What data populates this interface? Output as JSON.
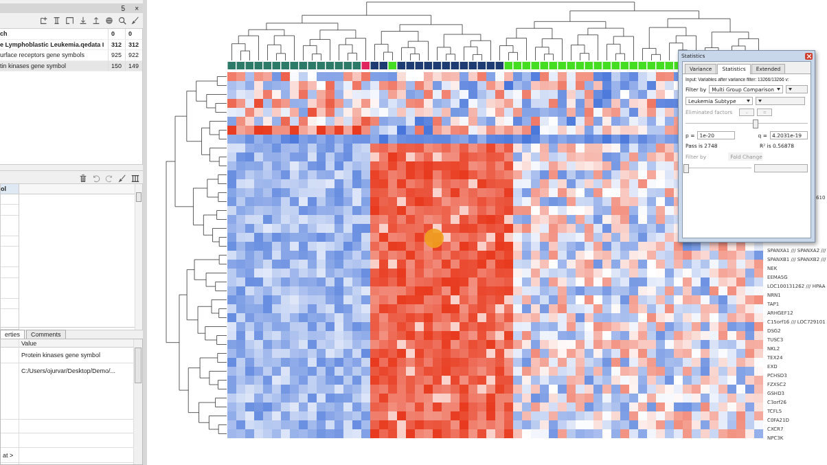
{
  "datasets_panel": {
    "float_button": "5",
    "close_button": "×",
    "rows": [
      {
        "name": "ch",
        "count_1": "0",
        "count_2": "0",
        "bold": true,
        "selected": false
      },
      {
        "name": "e Lymphoblastic Leukemia.qedata I",
        "count_1": "312",
        "count_2": "312",
        "bold": true,
        "selected": false
      },
      {
        "name": "urface receptors gene symbols",
        "count_1": "925",
        "count_2": "922",
        "bold": false,
        "selected": false
      },
      {
        "name": "tin kinases gene symbol",
        "count_1": "150",
        "count_2": "149",
        "bold": false,
        "selected": true
      }
    ]
  },
  "columns_panel": {
    "header": "ol"
  },
  "properties_panel": {
    "tabs": [
      {
        "label": "erties",
        "selected": true
      },
      {
        "label": "Comments",
        "selected": false
      }
    ],
    "value_header": "Value",
    "rows": [
      {
        "value": "Protein kinases gene symbol"
      },
      {
        "value": "C:/Users/ojurvar/Desktop/Demo/..."
      },
      {},
      {},
      {
        "label": "at >"
      }
    ]
  },
  "gene_labels": [
    "SPANXA1 /// SPANXA2 ///",
    "SPANXB1 /// SPANXB2 ///",
    "NEK",
    "EEMA5G",
    "LOC100131262 /// HPAA",
    "NRN1",
    "TAP1",
    "ARHGEF12",
    "C15orf16 /// LOC729101",
    "DSG2",
    "TUSC3",
    "NKL2",
    "TEX24",
    "EXD",
    "PCHSD3",
    "FZXSC2",
    "GSHD3",
    "C3orf26",
    "TCFL5",
    "C0FA21D",
    "CXCR7",
    "NPC3K"
  ],
  "partial_label": "610",
  "statistics_dialog": {
    "title": "Statistics",
    "tabs": [
      {
        "label": "Variance",
        "selected": false
      },
      {
        "label": "Statistics",
        "selected": true
      },
      {
        "label": "Extended",
        "selected": false
      }
    ],
    "input_text": "Input: Variables after variance filter: 13266/13266 v:",
    "filter_label": "Filter by",
    "filter_value": "Multi Group Comparison",
    "factor_value": "Leukemia Subtype",
    "eliminated_label": "Eliminated factors",
    "eliminated_buttons": [
      "-",
      "="
    ],
    "eliminated_disabled": true,
    "p_slider": {
      "level": 0.57
    },
    "p_label": "p =",
    "p_value": "1e-20",
    "q_label": "q =",
    "q_value": "4.2031e-19",
    "pass_text": "Pass is 2748",
    "r_text": "R² is 0.56878",
    "fold_label": "Filter by",
    "fold_value": "Fold Change",
    "fold_disabled": true,
    "fold_slider": {
      "level": 0
    }
  }
}
